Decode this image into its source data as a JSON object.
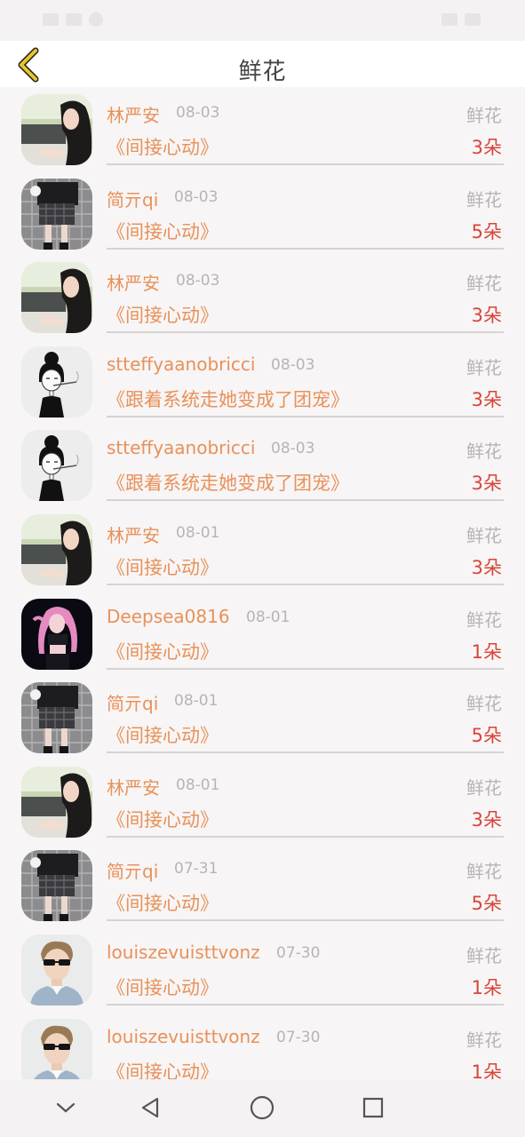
{
  "header": {
    "title": "鲜花",
    "back_icon": "chevron-left-icon",
    "back_color": "#e8c52a"
  },
  "colors": {
    "name": "#e8915a",
    "count": "#d8453a",
    "muted": "#b8b4b4"
  },
  "records": [
    {
      "user": "林严安",
      "date": "08-03",
      "type": "鲜花",
      "book": "《间接心动》",
      "count": "3朵",
      "avatar": "avatar-girl-outdoor"
    },
    {
      "user": "简亓qi",
      "date": "08-03",
      "type": "鲜花",
      "book": "《间接心动》",
      "count": "5朵",
      "avatar": "avatar-plaid-skirt"
    },
    {
      "user": "林严安",
      "date": "08-03",
      "type": "鲜花",
      "book": "《间接心动》",
      "count": "3朵",
      "avatar": "avatar-girl-outdoor"
    },
    {
      "user": "stteffyaanobricci",
      "date": "08-03",
      "type": "鲜花",
      "book": "《跟着系统走她变成了团宠》",
      "count": "3朵",
      "avatar": "avatar-sketch-girl"
    },
    {
      "user": "stteffyaanobricci",
      "date": "08-03",
      "type": "鲜花",
      "book": "《跟着系统走她变成了团宠》",
      "count": "3朵",
      "avatar": "avatar-sketch-girl"
    },
    {
      "user": "林严安",
      "date": "08-01",
      "type": "鲜花",
      "book": "《间接心动》",
      "count": "3朵",
      "avatar": "avatar-girl-outdoor"
    },
    {
      "user": "Deepsea0816",
      "date": "08-01",
      "type": "鲜花",
      "book": "《间接心动》",
      "count": "1朵",
      "avatar": "avatar-pink-hair"
    },
    {
      "user": "简亓qi",
      "date": "08-01",
      "type": "鲜花",
      "book": "《间接心动》",
      "count": "5朵",
      "avatar": "avatar-plaid-skirt"
    },
    {
      "user": "林严安",
      "date": "08-01",
      "type": "鲜花",
      "book": "《间接心动》",
      "count": "3朵",
      "avatar": "avatar-girl-outdoor"
    },
    {
      "user": "简亓qi",
      "date": "07-31",
      "type": "鲜花",
      "book": "《间接心动》",
      "count": "5朵",
      "avatar": "avatar-plaid-skirt"
    },
    {
      "user": "louiszevuisttvonz",
      "date": "07-30",
      "type": "鲜花",
      "book": "《间接心动》",
      "count": "1朵",
      "avatar": "avatar-man-sunglasses"
    },
    {
      "user": "louiszevuisttvonz",
      "date": "07-30",
      "type": "鲜花",
      "book": "《间接心动》",
      "count": "1朵",
      "avatar": "avatar-man-sunglasses"
    }
  ],
  "navbar": {
    "icons": [
      "chevron-down-icon",
      "back-triangle-icon",
      "home-circle-icon",
      "recents-square-icon"
    ]
  }
}
